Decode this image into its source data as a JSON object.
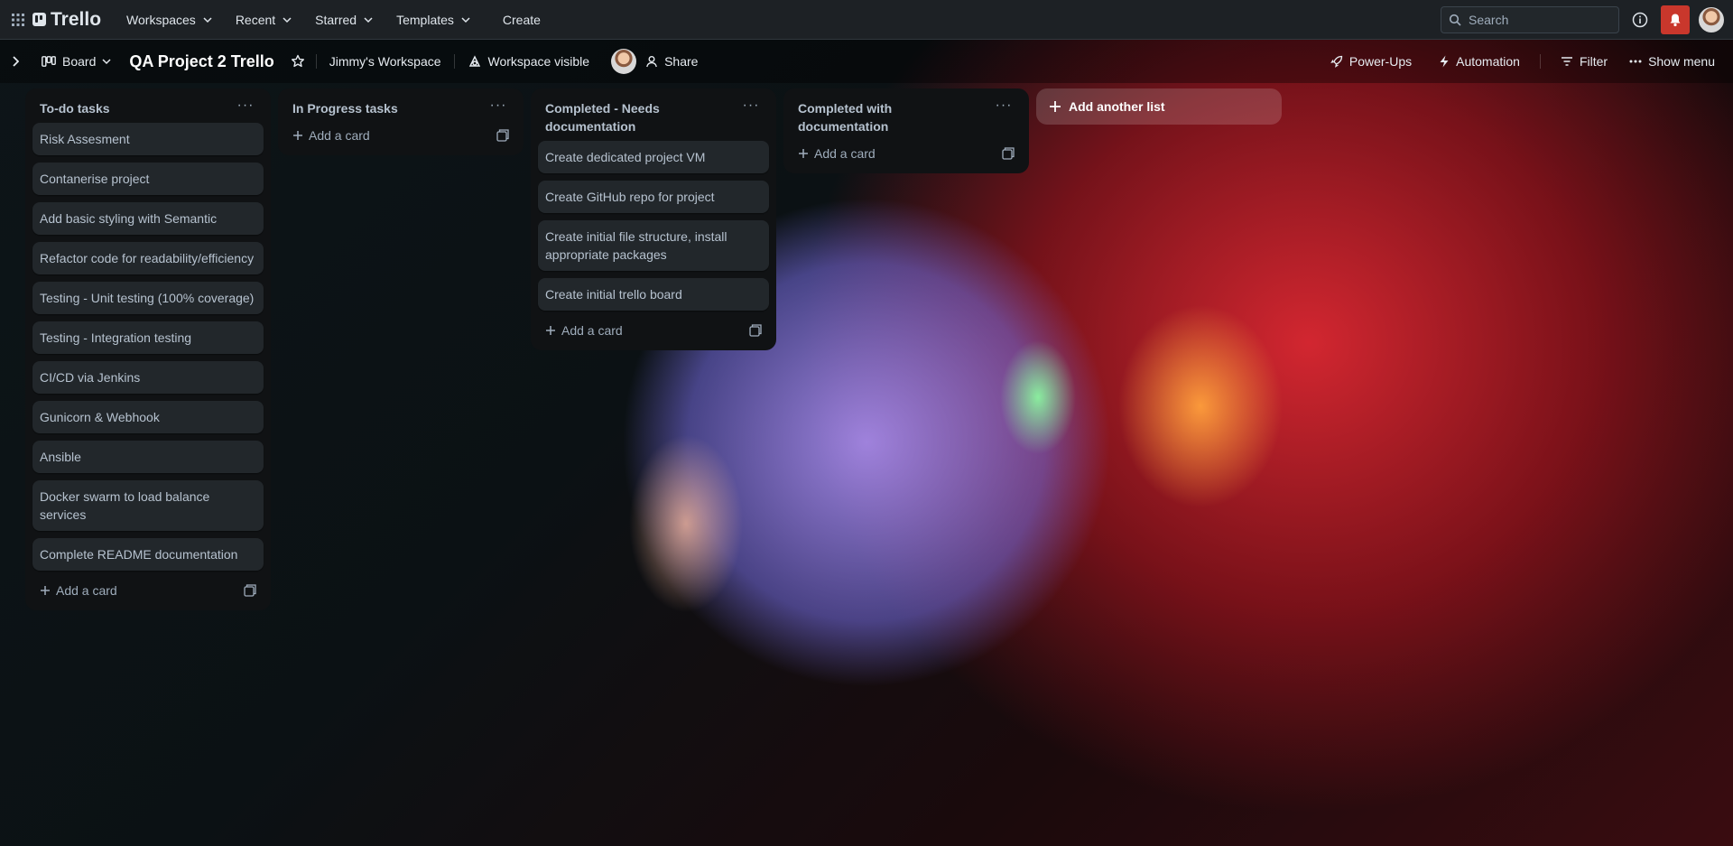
{
  "topbar": {
    "app_name": "Trello",
    "nav": [
      {
        "label": "Workspaces"
      },
      {
        "label": "Recent"
      },
      {
        "label": "Starred"
      },
      {
        "label": "Templates"
      }
    ],
    "create_label": "Create",
    "search_placeholder": "Search"
  },
  "boardbar": {
    "view_label": "Board",
    "title": "QA Project 2 Trello",
    "workspace": "Jimmy's Workspace",
    "visibility": "Workspace visible",
    "share": "Share",
    "power_ups": "Power-Ups",
    "automation": "Automation",
    "filter": "Filter",
    "show_menu": "Show menu"
  },
  "lists": [
    {
      "title": "To-do tasks",
      "cards": [
        "Risk Assesment",
        "Contanerise project",
        "Add basic styling with Semantic",
        "Refactor code for readability/efficiency",
        "Testing - Unit testing (100% coverage)",
        "Testing - Integration testing",
        "CI/CD via Jenkins",
        "Gunicorn & Webhook",
        "Ansible",
        "Docker swarm to load balance services",
        "Complete README documentation"
      ],
      "add_card": "Add a card"
    },
    {
      "title": "In Progress tasks",
      "cards": [],
      "add_card": "Add a card"
    },
    {
      "title": "Completed - Needs documentation",
      "cards": [
        "Create dedicated project VM",
        "Create GitHub repo for project",
        "Create initial file structure, install appropriate packages",
        "Create initial trello board"
      ],
      "add_card": "Add a card"
    },
    {
      "title": "Completed with documentation",
      "cards": [],
      "add_card": "Add a card"
    }
  ],
  "add_list_label": "Add another list",
  "colors": {
    "topbar_bg": "#1d2125",
    "list_bg": "#101214",
    "card_bg": "#22272b",
    "text": "#b6c2cf",
    "notification": "#c9372c"
  }
}
